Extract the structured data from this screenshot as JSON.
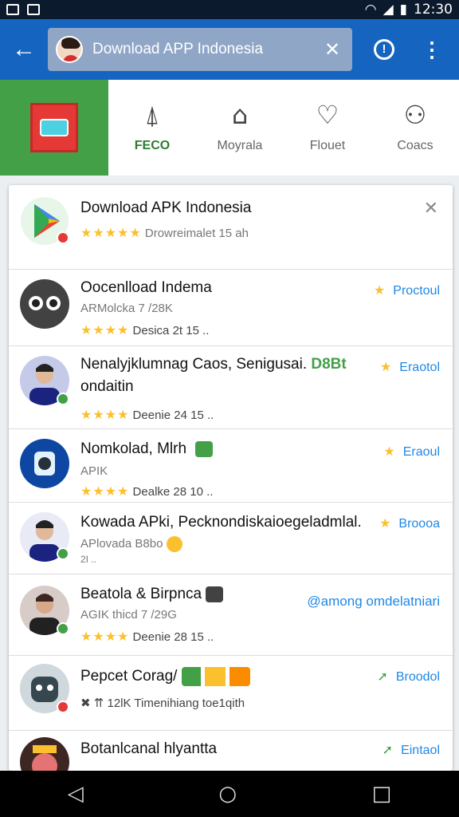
{
  "status": {
    "time": "12:30"
  },
  "search": {
    "query": "Download APP Indonesia"
  },
  "tabs": [
    {
      "label": "FECO",
      "icon": "⍋",
      "icon_name": "bell-icon"
    },
    {
      "label": "Moyrala",
      "icon": "⌂",
      "icon_name": "home-icon"
    },
    {
      "label": "Flouet",
      "icon": "♡",
      "icon_name": "heart-icon"
    },
    {
      "label": "Coacs",
      "icon": "⚇",
      "icon_name": "person-icon"
    }
  ],
  "results": [
    {
      "title": "Download APK Indonesia",
      "rating": "★★★★★",
      "meta": "Drowreimalet 15 ah"
    },
    {
      "title": "Oocenlload Indema",
      "sub": "ARMolcka 7 /28K",
      "rating": "★★★★",
      "meta": "Desica  2t  15  ..",
      "action": "Proctoul"
    },
    {
      "title": "Nenalyjklumnag Caos, Senigusai.",
      "title_tag": "D8Bt",
      "sub": "ondaitin",
      "rating": "★★★★",
      "meta": "Deenie  24  15  ..",
      "action": "Eraotol"
    },
    {
      "title": "Nomkolad, Mlrh",
      "sub": "APIK",
      "rating": "★★★★",
      "meta": "Dealke  28  10  ..",
      "action": "Eraoul"
    },
    {
      "title": "Kowada APki, Pecknondiskaioegeladmlal.",
      "sub": "APlovada B8bo",
      "meta": "2I  ..",
      "action": "Broooa"
    },
    {
      "title": "Beatola & Birpnca",
      "sub": "AGIK thicd 7 /29G",
      "rating": "★★★★",
      "meta": "Deenie  28  15  ..",
      "action": "@among omdelatniari"
    },
    {
      "title": "Pepcet Corag/",
      "meta": "✖ ⇈ 12lK  Timenihiang  toe1qith",
      "action": "Broodol"
    },
    {
      "title": "Botanlcanal hlyantta",
      "action": "Eintaol"
    }
  ]
}
